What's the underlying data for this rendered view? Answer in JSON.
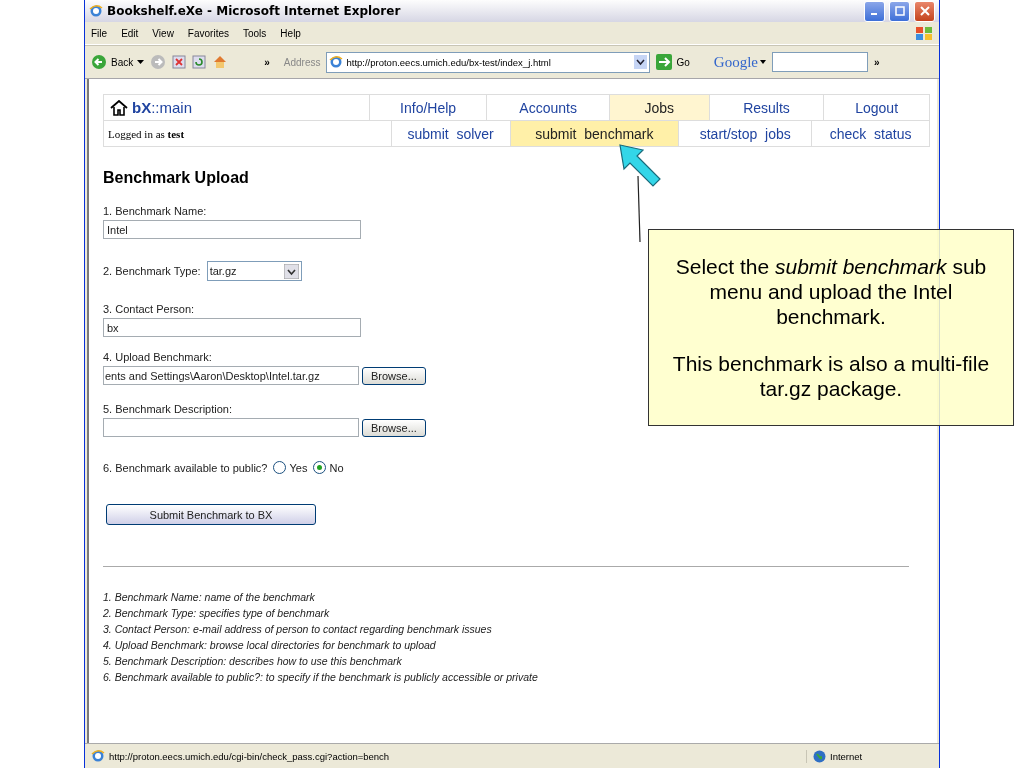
{
  "window": {
    "title": "Bookshelf.eXe - Microsoft Internet Explorer"
  },
  "menu": [
    "File",
    "Edit",
    "View",
    "Favorites",
    "Tools",
    "Help"
  ],
  "toolbar": {
    "back": "Back",
    "chevron": "»",
    "address_label": "Address",
    "url": "http://proton.eecs.umich.edu/bx-test/index_j.html",
    "go": "Go",
    "search_brand": "Google",
    "end_chevron": "»"
  },
  "nav": {
    "brand": {
      "bold": "bX",
      "rest": "::main"
    },
    "tabs": [
      {
        "label": "Info/Help",
        "selected": false
      },
      {
        "label": "Accounts",
        "selected": false
      },
      {
        "label": "Jobs",
        "selected": true
      },
      {
        "label": "Results",
        "selected": false
      },
      {
        "label": "Logout",
        "selected": false
      }
    ],
    "login": "Logged in as **test**",
    "subtabs": [
      {
        "label": "submit  solver",
        "selected": false
      },
      {
        "label": "submit  benchmark",
        "selected": true
      },
      {
        "label": "start/stop  jobs",
        "selected": false
      },
      {
        "label": "check  status",
        "selected": false
      }
    ]
  },
  "form": {
    "heading": "Benchmark Upload",
    "fields": [
      {
        "kind": "text",
        "label": "1. Benchmark Name:",
        "value": "Intel"
      },
      {
        "kind": "select",
        "label": "2. Benchmark Type:",
        "value": "tar.gz"
      },
      {
        "kind": "text",
        "label": "3. Contact Person:",
        "value": "bx"
      },
      {
        "kind": "file",
        "label": "4. Upload Benchmark:",
        "value": "ents and Settings\\Aaron\\Desktop\\Intel.tar.gz",
        "button": "Browse..."
      },
      {
        "kind": "file",
        "label": "5. Benchmark Description:",
        "button": "Browse..."
      },
      {
        "kind": "radio",
        "label": "6. Benchmark available to public?",
        "options": [
          {
            "label": "Yes",
            "selected": false
          },
          {
            "label": "No",
            "selected": true
          }
        ]
      }
    ],
    "submit": "Submit Benchmark to BX"
  },
  "notes": [
    "1. Benchmark Name: name of the benchmark",
    "2. Benchmark Type: specifies type of benchmark",
    "3. Contact Person: e-mail address of person to contact regarding benchmark issues",
    "4. Upload Benchmark: browse local directories for benchmark to upload",
    "5. Benchmark Description: describes how to use this benchmark",
    "6. Benchmark available to public?: to specify if the benchmark is publicly accessible or private"
  ],
  "status_bar": {
    "url": "http://proton.eecs.umich.edu/cgi-bin/check_pass.cgi?action=bench",
    "zone": "Internet"
  },
  "callout": {
    "paragraphs": [
      "Select the *submit benchmark* sub menu and upload the Intel benchmark.",
      "This benchmark is also a multi-file tar.gz package."
    ]
  }
}
